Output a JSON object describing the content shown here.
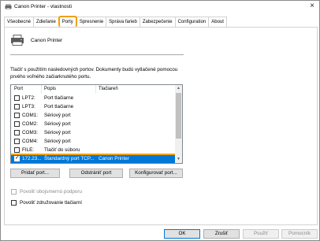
{
  "window": {
    "title": "Canon Printer - vlastnosti",
    "close_glyph": "×"
  },
  "tabs": [
    {
      "label": "Všeobecné"
    },
    {
      "label": "Zdieľanie"
    },
    {
      "label": "Porty",
      "active": true
    },
    {
      "label": "Spresnenie"
    },
    {
      "label": "Správa farieb"
    },
    {
      "label": "Zabezpečenie"
    },
    {
      "label": "Configuration"
    },
    {
      "label": "About"
    }
  ],
  "printer": {
    "name": "Canon Printer"
  },
  "description": "Tlačiť s použitím nasledovných portov. Dokumenty budú vytlačené pomocou prvého voľného začiarknutého portu.",
  "port_list": {
    "columns": [
      "Port",
      "Popis",
      "Tlačiareň"
    ],
    "rows": [
      {
        "port": "LPT2:",
        "description": "Port tlačiarne",
        "printer": "",
        "checked": false
      },
      {
        "port": "LPT3:",
        "description": "Port tlačiarne",
        "printer": "",
        "checked": false
      },
      {
        "port": "COM1:",
        "description": "Sériový port",
        "printer": "",
        "checked": false
      },
      {
        "port": "COM2:",
        "description": "Sériový port",
        "printer": "",
        "checked": false
      },
      {
        "port": "COM3:",
        "description": "Sériový port",
        "printer": "",
        "checked": false
      },
      {
        "port": "COM4:",
        "description": "Sériový port",
        "printer": "",
        "checked": false
      },
      {
        "port": "FILE:",
        "description": "Tlačiť do súboru",
        "printer": "",
        "checked": false
      },
      {
        "port": "172.23...",
        "description": "Štandardný port TCP...",
        "printer": "Canon Printer",
        "checked": true,
        "selected": true
      }
    ],
    "scroll_up": "▲",
    "scroll_down": "▼"
  },
  "port_buttons": {
    "add": "Pridať port...",
    "delete": "Odstrániť port",
    "configure": "Konfigurovať port..."
  },
  "options": {
    "bidirectional": "Povoliť obojsmernú podporu",
    "pooling": "Povoliť združovanie tlačiarní"
  },
  "footer": {
    "ok": "OK",
    "cancel": "Zrušiť",
    "apply": "Použiť",
    "help": "Pomocník"
  },
  "colors": {
    "accent_highlight": "#f0a000",
    "selection": "#0078d7"
  }
}
